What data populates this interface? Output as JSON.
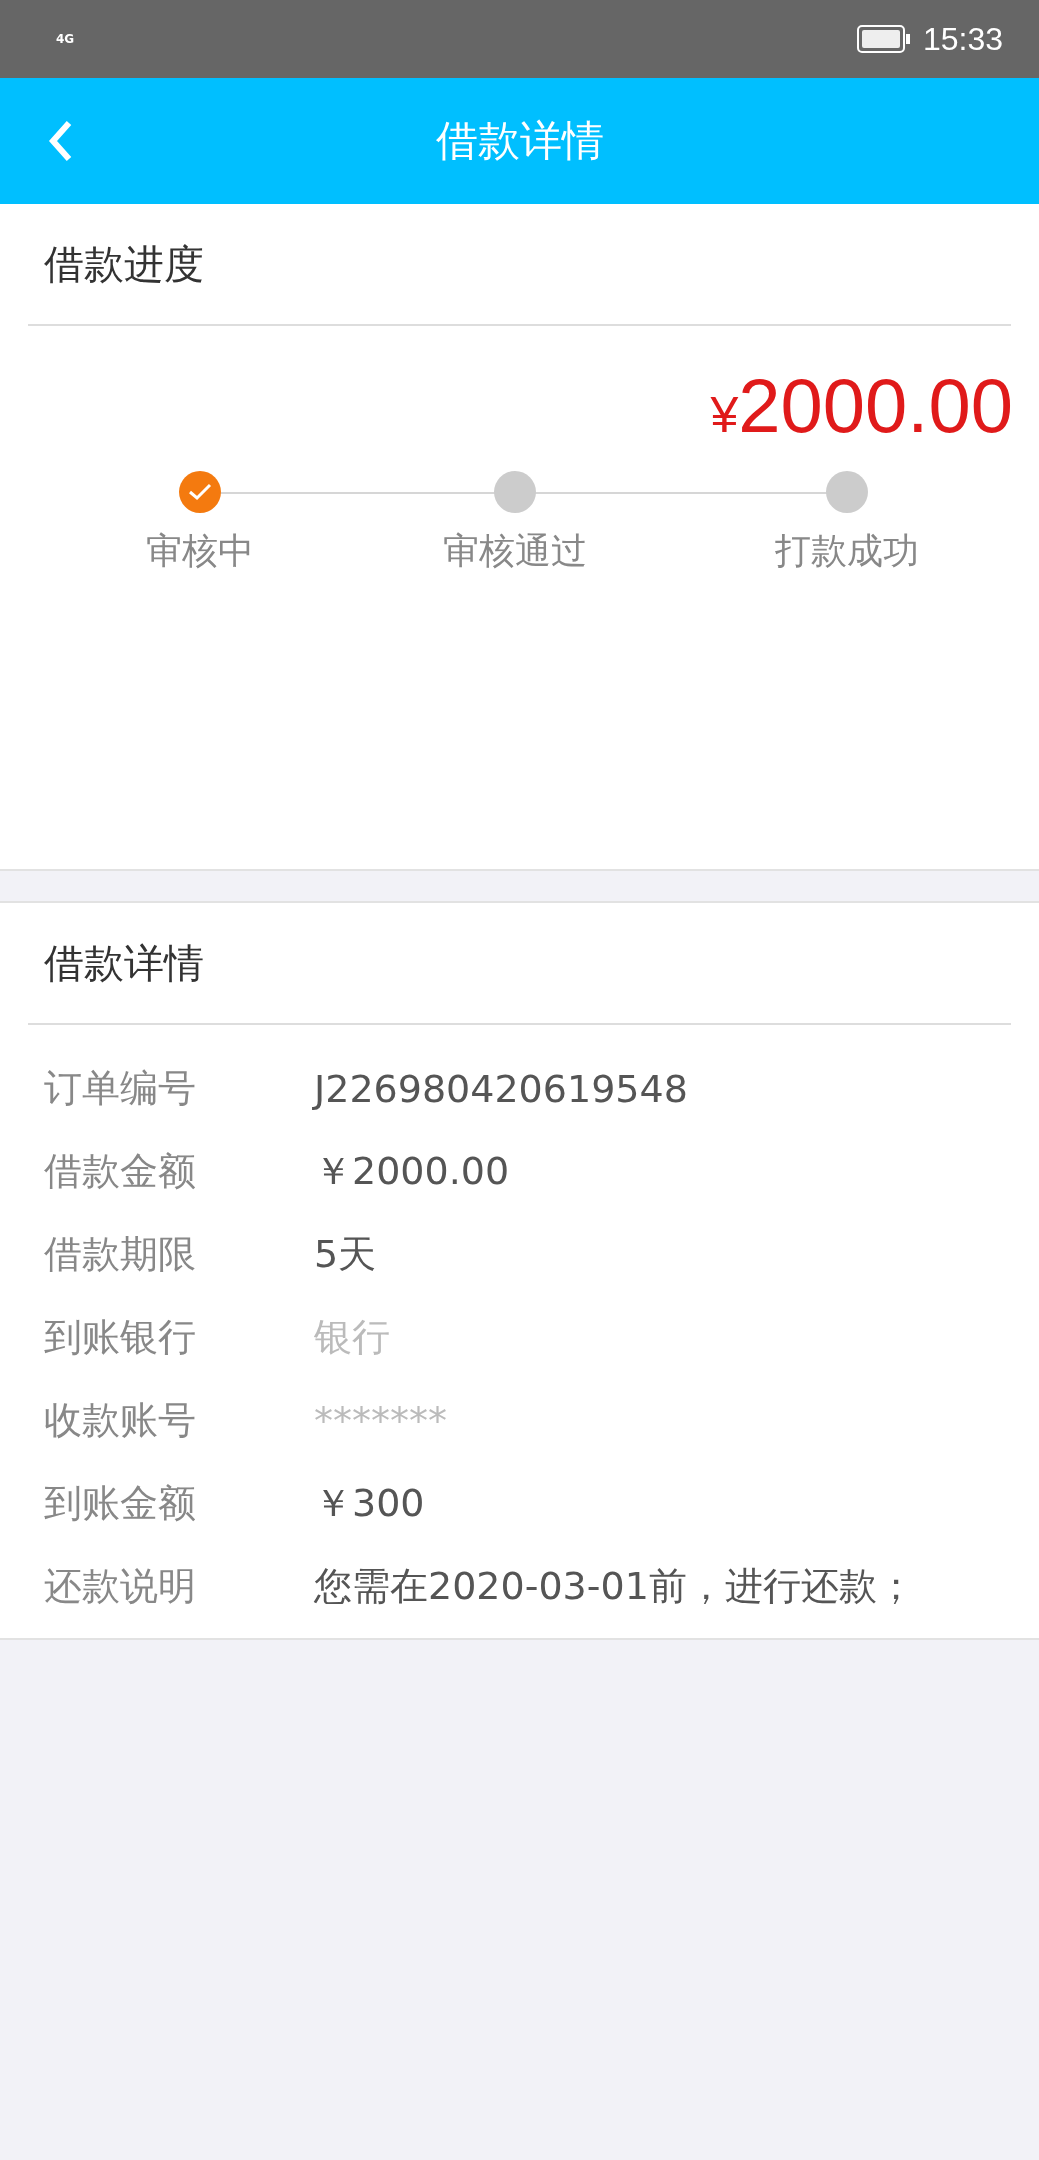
{
  "status_bar": {
    "network": "4G",
    "time": "15:33"
  },
  "header": {
    "title": "借款详情"
  },
  "progress": {
    "title": "借款进度",
    "amount": "¥2000.00",
    "steps": [
      {
        "label": "审核中",
        "done": true
      },
      {
        "label": "审核通过",
        "done": false
      },
      {
        "label": "打款成功",
        "done": false
      }
    ]
  },
  "details": {
    "title": "借款详情",
    "rows": [
      {
        "label": "订单编号",
        "value": "J226980420619548"
      },
      {
        "label": "借款金额",
        "value": "￥2000.00"
      },
      {
        "label": "借款期限",
        "value": "5天"
      },
      {
        "label": "到账银行",
        "value": "银行",
        "redacted": true
      },
      {
        "label": "收款账号",
        "value": "*******",
        "redacted": true
      },
      {
        "label": "到账金额",
        "value": "￥300"
      },
      {
        "label": "还款说明",
        "value": "您需在2020-03-01前，进行还款；"
      }
    ]
  }
}
